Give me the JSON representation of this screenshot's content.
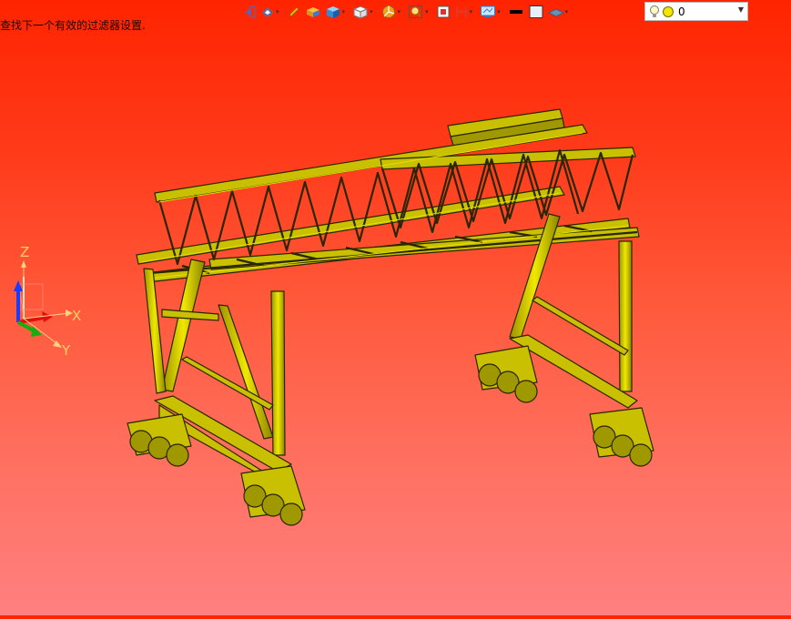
{
  "status": {
    "message": "查找下一个有效的过滤器设置."
  },
  "toolbar": {
    "icons": [
      {
        "name": "exit-sketch-icon",
        "color": "#3b6fd8"
      },
      {
        "name": "render-style-icon",
        "color": "#5470a8"
      },
      {
        "name": "pencil-icon",
        "color": "#e6b400"
      },
      {
        "name": "box-model-icon",
        "color": "#f0a020"
      },
      {
        "name": "shaded-cube-icon",
        "color": "#2d8fdc"
      },
      {
        "name": "white-cube-icon",
        "color": "#8a8a8a"
      },
      {
        "name": "color-wheel-icon",
        "color": "#f0a020"
      },
      {
        "name": "zoom-view-icon",
        "color": "#e0a040"
      },
      {
        "name": "section-view-icon",
        "color": "#e03030"
      },
      {
        "name": "clipping-plane-icon",
        "color": "#d04040"
      },
      {
        "name": "monitor-display-icon",
        "color": "#2a7fd0"
      },
      {
        "name": "line-color-icon",
        "color": "#000000"
      },
      {
        "name": "fill-color-icon",
        "color": "#e8eef8"
      },
      {
        "name": "layer-plane-icon",
        "color": "#6a8fb0"
      }
    ]
  },
  "layer": {
    "value": "0"
  },
  "triad": {
    "x_label": "X",
    "y_label": "Y",
    "z_label": "Z"
  },
  "model": {
    "color": "#c8c000",
    "edge_color": "#2a2600"
  }
}
